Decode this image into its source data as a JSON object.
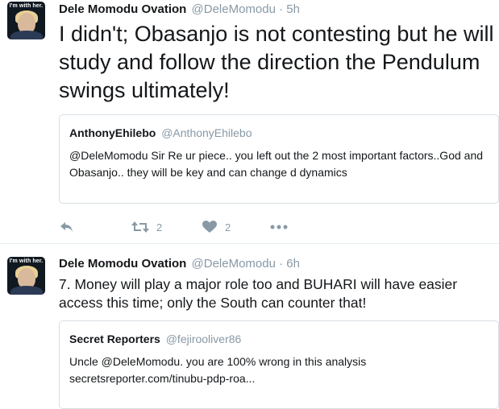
{
  "tweets": [
    {
      "author_name": "Dele Momodu Ovation",
      "handle": "@DeleMomodu",
      "separator": "·",
      "time": "5h",
      "avatar_banner": "I'm with her.",
      "text": "I didn't; Obasanjo is not contesting but he will study and follow the direction the Pendulum swings ultimately!",
      "quoted": {
        "author_name": "AnthonyEhilebo",
        "handle": "@AnthonyEhilebo",
        "text_line1": "@DeleMomodu Sir Re ur piece.. you left out the 2 most important factors..God and",
        "text_line2": "Obasanjo.. they will be key and can change d dynamics"
      },
      "actions": {
        "reply_icon": "reply-icon",
        "retweet_icon": "retweet-icon",
        "retweet_count": "2",
        "like_icon": "heart-icon",
        "like_count": "2",
        "more_icon": "more-dots-icon"
      }
    },
    {
      "author_name": "Dele Momodu Ovation",
      "handle": "@DeleMomodu",
      "separator": "·",
      "time": "6h",
      "avatar_banner": "I'm with her.",
      "text": "7. Money will play a major role too and BUHARI will have easier access this time; only the South can counter that!",
      "quoted": {
        "author_name": "Secret Reporters",
        "handle": "@fejirooliver86",
        "text_line1": "Uncle @DeleMomodu. you are 100% wrong in this analysis",
        "text_line2": "secretsreporter.com/tinubu-pdp-roa..."
      }
    }
  ],
  "colors": {
    "text": "#14171a",
    "muted": "#8899a6",
    "border": "#e6ecf0",
    "quote_border": "#d8dfe4"
  }
}
